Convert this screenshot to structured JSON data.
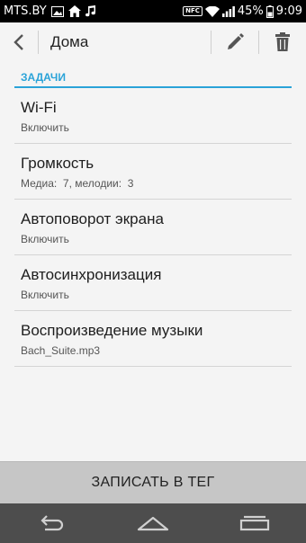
{
  "status_bar": {
    "carrier": "MTS.BY",
    "nfc_label": "NFC",
    "battery_percent": "45%",
    "time": "9:09",
    "icons": [
      "image-icon",
      "home-icon",
      "music-note-icon",
      "nfc-icon",
      "wifi-icon",
      "signal-icon",
      "battery-icon"
    ]
  },
  "action_bar": {
    "title": "Дома",
    "icons": [
      "back-chevron-icon",
      "edit-pencil-icon",
      "trash-icon"
    ]
  },
  "section": {
    "header": "ЗАДАЧИ"
  },
  "tasks": [
    {
      "title": "Wi-Fi",
      "subtitle": "Включить"
    },
    {
      "title": "Громкость",
      "subtitle": "Медиа:  7, мелодии:  3"
    },
    {
      "title": "Автоповорот экрана",
      "subtitle": "Включить"
    },
    {
      "title": "Автосинхронизация",
      "subtitle": "Включить"
    },
    {
      "title": "Воспроизведение музыки",
      "subtitle": "Bach_Suite.mp3"
    }
  ],
  "footer": {
    "write_button": "ЗАПИСАТЬ В ТЕГ"
  },
  "nav_bar": {
    "icons": [
      "nav-back-icon",
      "nav-home-icon",
      "nav-recents-icon"
    ]
  },
  "colors": {
    "accent": "#2aa3d8",
    "background": "#f4f4f4",
    "button_bg": "#c6c6c6",
    "nav_bg": "#4d4d4d"
  }
}
